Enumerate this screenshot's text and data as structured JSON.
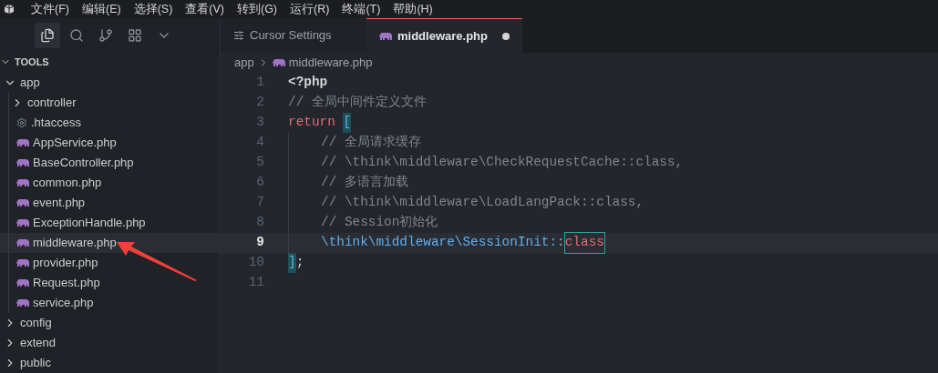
{
  "menu_bar": {
    "items": [
      "文件(F)",
      "编辑(E)",
      "选择(S)",
      "查看(V)",
      "转到(G)",
      "运行(R)",
      "终端(T)",
      "帮助(H)"
    ]
  },
  "activity_bar": {
    "items": [
      {
        "kind": "files",
        "selected": true
      },
      {
        "kind": "search",
        "selected": false
      },
      {
        "kind": "source-control",
        "selected": false
      },
      {
        "kind": "extensions",
        "selected": false
      },
      {
        "kind": "more",
        "selected": false
      }
    ]
  },
  "explorer": {
    "root": {
      "label": "TOOLS",
      "expanded": true
    },
    "tree": [
      {
        "label": "app",
        "kind": "folder",
        "expanded": true,
        "selected": false,
        "children": [
          {
            "label": "controller",
            "kind": "folder",
            "expanded": false,
            "selected": false
          },
          {
            "label": ".htaccess",
            "kind": "config",
            "selected": false
          },
          {
            "label": "AppService.php",
            "kind": "php",
            "selected": false
          },
          {
            "label": "BaseController.php",
            "kind": "php",
            "selected": false
          },
          {
            "label": "common.php",
            "kind": "php",
            "selected": false
          },
          {
            "label": "event.php",
            "kind": "php",
            "selected": false
          },
          {
            "label": "ExceptionHandle.php",
            "kind": "php",
            "selected": false
          },
          {
            "label": "middleware.php",
            "kind": "php",
            "selected": true
          },
          {
            "label": "provider.php",
            "kind": "php",
            "selected": false
          },
          {
            "label": "Request.php",
            "kind": "php",
            "selected": false
          },
          {
            "label": "service.php",
            "kind": "php",
            "selected": false
          }
        ]
      },
      {
        "label": "config",
        "kind": "folder",
        "expanded": false,
        "selected": false
      },
      {
        "label": "extend",
        "kind": "folder",
        "expanded": false,
        "selected": false
      },
      {
        "label": "public",
        "kind": "folder",
        "expanded": false,
        "selected": false
      }
    ]
  },
  "tabs": [
    {
      "label": "Cursor Settings",
      "kind": "settings",
      "selected": false,
      "modified": false
    },
    {
      "label": "middleware.php",
      "kind": "php",
      "selected": true,
      "modified": true
    }
  ],
  "breadcrumb": [
    {
      "label": "app",
      "kind": "folder"
    },
    {
      "label": "middleware.php",
      "kind": "php"
    }
  ],
  "code": [
    {
      "number": "1",
      "current": false,
      "indent": false,
      "tokens": [
        {
          "text": "<?php",
          "kind": "tag"
        }
      ]
    },
    {
      "number": "2",
      "current": false,
      "indent": false,
      "tokens": [
        {
          "text": "// 全局中间件定义文件",
          "kind": "comment"
        }
      ]
    },
    {
      "number": "3",
      "current": false,
      "indent": false,
      "tokens": [
        {
          "text": "return",
          "kind": "keyword"
        },
        {
          "text": "[",
          "kind": "bracket"
        }
      ]
    },
    {
      "number": "4",
      "current": false,
      "indent": true,
      "tokens": [
        {
          "text": "// 全局请求缓存",
          "kind": "comment"
        }
      ]
    },
    {
      "number": "5",
      "current": false,
      "indent": true,
      "tokens": [
        {
          "text": "// \\think\\middleware\\CheckRequestCache::class,",
          "kind": "comment"
        }
      ]
    },
    {
      "number": "6",
      "current": false,
      "indent": true,
      "tokens": [
        {
          "text": "// 多语言加载",
          "kind": "comment"
        }
      ]
    },
    {
      "number": "7",
      "current": false,
      "indent": true,
      "tokens": [
        {
          "text": "// \\think\\middleware\\LoadLangPack::class,",
          "kind": "comment"
        }
      ]
    },
    {
      "number": "8",
      "current": false,
      "indent": true,
      "tokens": [
        {
          "text": "// Session初始化",
          "kind": "comment"
        }
      ]
    },
    {
      "number": "9",
      "current": true,
      "indent": true,
      "tokens": [
        {
          "text": "\\think\\middleware\\SessionInit",
          "kind": "namespace"
        },
        {
          "text": "::",
          "kind": "operator"
        },
        {
          "text": "class",
          "kind": "highlighted-keyword"
        }
      ]
    },
    {
      "number": "10",
      "current": false,
      "indent": false,
      "tokens": [
        {
          "text": "]",
          "kind": "bracket"
        },
        {
          "text": ";",
          "kind": "plain"
        }
      ]
    },
    {
      "number": "11",
      "current": false,
      "indent": false
    }
  ]
}
